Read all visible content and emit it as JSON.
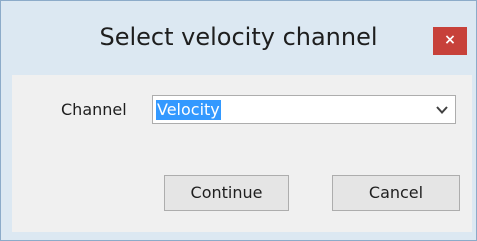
{
  "dialog": {
    "title": "Select velocity channel",
    "close_label": "×"
  },
  "form": {
    "channel_label": "Channel",
    "channel_value": "Velocity"
  },
  "buttons": {
    "continue_label": "Continue",
    "cancel_label": "Cancel"
  },
  "icons": {
    "dropdown": "chevron-down-icon",
    "close": "close-icon"
  },
  "colors": {
    "close_button": "#c7413a",
    "selection": "#3399ff",
    "title_bar": "#dce8f2"
  }
}
